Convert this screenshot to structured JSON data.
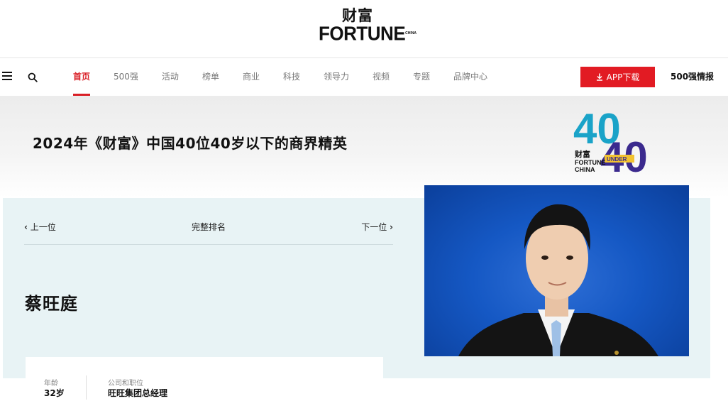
{
  "header": {
    "logo_cn": "财富",
    "logo_en": "FORTUNE",
    "logo_en_suffix": "CHINA"
  },
  "nav": {
    "menu_icon": "hamburger-icon",
    "search_icon": "search-icon",
    "items": [
      {
        "label": "首页",
        "active": true
      },
      {
        "label": "500强",
        "active": false
      },
      {
        "label": "活动",
        "active": false
      },
      {
        "label": "榜单",
        "active": false
      },
      {
        "label": "商业",
        "active": false
      },
      {
        "label": "科技",
        "active": false
      },
      {
        "label": "领导力",
        "active": false
      },
      {
        "label": "视频",
        "active": false
      },
      {
        "label": "专题",
        "active": false
      },
      {
        "label": "品牌中心",
        "active": false
      }
    ],
    "app_button_label": "APP下载",
    "app_button_icon": "download-icon",
    "intel_label": "500强情报",
    "accent_color": "#e21b23"
  },
  "hero": {
    "title": "2024年《财富》中国40位40岁以下的商界精英",
    "badge": {
      "top_number": "40",
      "bottom_number": "40",
      "under_label": "UNDER",
      "brand_cn": "财富",
      "brand_en1": "FORTUNE",
      "brand_en2": "CHINA",
      "color_teal": "#1aa3c8",
      "color_purple": "#3b2a8e"
    }
  },
  "profile": {
    "prev_label": "上一位",
    "full_ranking_label": "完整排名",
    "next_label": "下一位",
    "name": "蔡旺庭",
    "age_label": "年龄",
    "age_value": "32岁",
    "company_label": "公司和职位",
    "company_value": "旺旺集团总经理",
    "panel_color": "#e8f3f5",
    "photo_bg_color": "#1558c4"
  }
}
